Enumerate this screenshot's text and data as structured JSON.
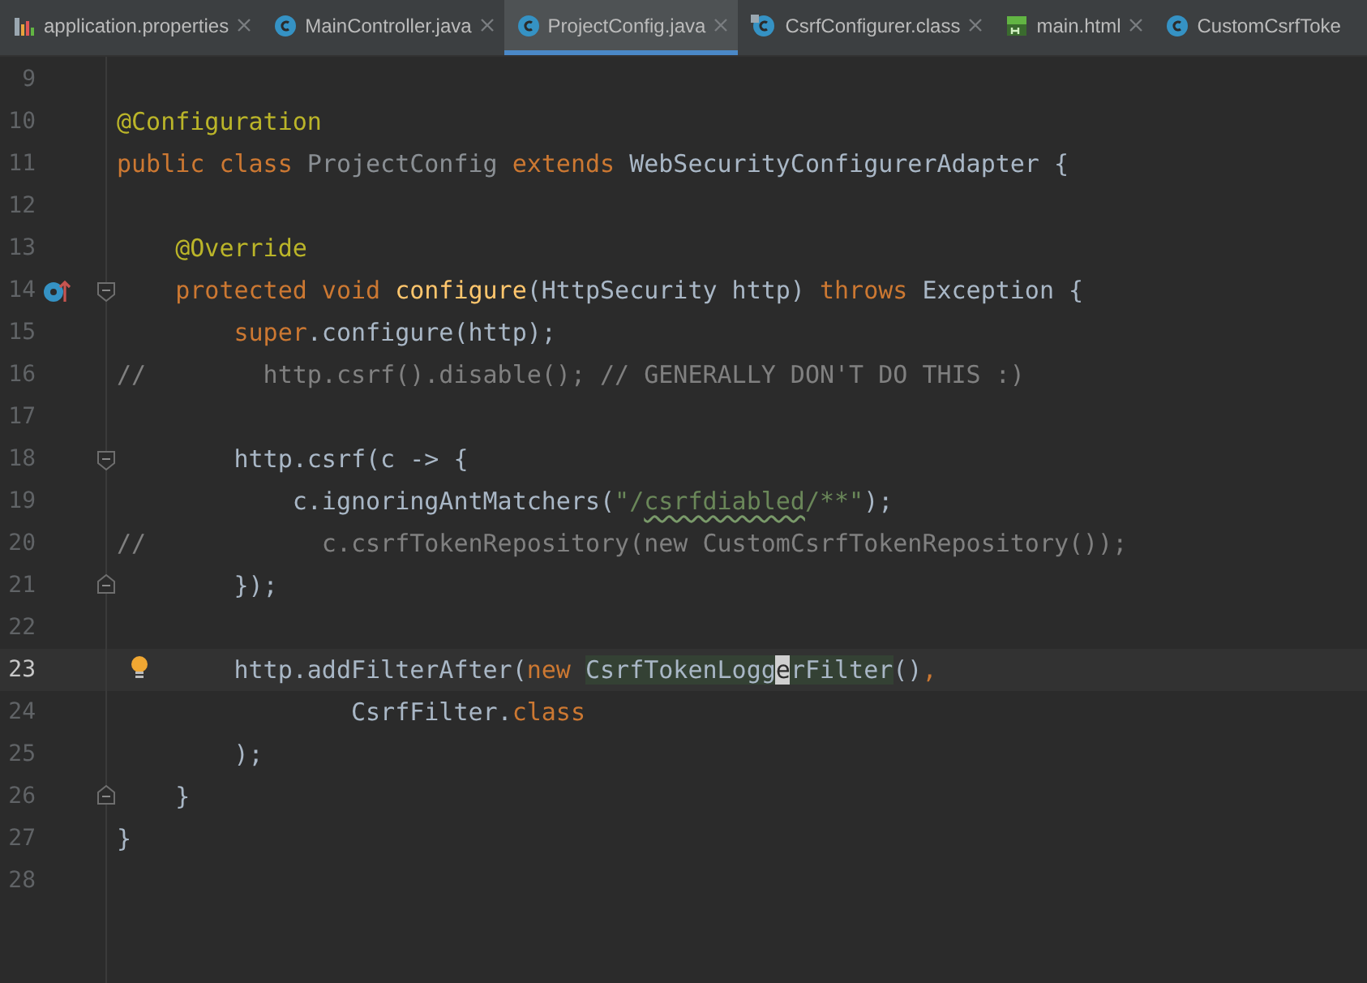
{
  "tabs": [
    {
      "label": "application.properties",
      "kind": "properties",
      "selected": false
    },
    {
      "label": "MainController.java",
      "kind": "class",
      "selected": false
    },
    {
      "label": "ProjectConfig.java",
      "kind": "class",
      "selected": true
    },
    {
      "label": "CsrfConfigurer.class",
      "kind": "compiled",
      "selected": false
    },
    {
      "label": "main.html",
      "kind": "html",
      "selected": false
    },
    {
      "label": "CustomCsrfToke",
      "kind": "class",
      "selected": false
    }
  ],
  "lines": [
    {
      "number": "9",
      "current": false
    },
    {
      "number": "10",
      "current": false,
      "tokens": [
        {
          "kind": "annotation",
          "t": "@Configuration"
        }
      ]
    },
    {
      "number": "11",
      "current": false,
      "tokens": [
        {
          "kind": "keyword",
          "t": "public class "
        },
        {
          "kind": "unused",
          "t": "ProjectConfig"
        },
        {
          "kind": "keyword",
          "t": " extends "
        },
        {
          "kind": "plain",
          "t": "WebSecurityConfigurerAdapter {"
        }
      ]
    },
    {
      "number": "12",
      "current": false
    },
    {
      "number": "13",
      "current": false,
      "tokens": [
        {
          "kind": "annotation",
          "t": "    @Override"
        }
      ]
    },
    {
      "number": "14",
      "current": false,
      "marker": {
        "kind": "override"
      },
      "fold": {
        "kind": "start"
      },
      "tokens": [
        {
          "kind": "keyword",
          "t": "    protected void "
        },
        {
          "kind": "method",
          "t": "configure"
        },
        {
          "kind": "plain",
          "t": "(HttpSecurity http) "
        },
        {
          "kind": "keyword",
          "t": "throws"
        },
        {
          "kind": "plain",
          "t": " Exception {"
        }
      ]
    },
    {
      "number": "15",
      "current": false,
      "tokens": [
        {
          "kind": "keyword",
          "t": "        super"
        },
        {
          "kind": "plain",
          "t": ".configure(http);"
        }
      ]
    },
    {
      "number": "16",
      "current": false,
      "tokens": [
        {
          "kind": "comment",
          "t": "//        http.csrf().disable(); // GENERALLY DON'T DO THIS :)"
        }
      ]
    },
    {
      "number": "17",
      "current": false
    },
    {
      "number": "18",
      "current": false,
      "fold": {
        "kind": "start"
      },
      "tokens": [
        {
          "kind": "plain",
          "t": "        http.csrf(c -> {"
        }
      ]
    },
    {
      "number": "19",
      "current": false,
      "tokens": [
        {
          "kind": "plain",
          "t": "            c.ignoringAntMatchers("
        },
        {
          "kind": "string",
          "t": "\"/"
        },
        {
          "kind": "typo",
          "t": "csrfdiabled"
        },
        {
          "kind": "string",
          "t": "/**\""
        },
        {
          "kind": "plain",
          "t": ");"
        }
      ]
    },
    {
      "number": "20",
      "current": false,
      "tokens": [
        {
          "kind": "comment",
          "t": "//            c.csrfTokenRepository(new CustomCsrfTokenRepository());"
        }
      ]
    },
    {
      "number": "21",
      "current": false,
      "fold": {
        "kind": "end"
      },
      "tokens": [
        {
          "kind": "plain",
          "t": "        });"
        }
      ]
    },
    {
      "number": "22",
      "current": false
    },
    {
      "number": "23",
      "current": true,
      "marker": {
        "kind": "bulb"
      },
      "tokens": [
        {
          "kind": "plain",
          "t": "        http.addFilterAfter("
        },
        {
          "kind": "keyword",
          "t": "new "
        },
        {
          "kind": "highlight",
          "t": "CsrfTokenLogg"
        },
        {
          "kind": "caret",
          "t": "e"
        },
        {
          "kind": "highlight",
          "t": "rFilter"
        },
        {
          "kind": "plain",
          "t": "()"
        },
        {
          "kind": "keyword",
          "t": ","
        }
      ]
    },
    {
      "number": "24",
      "current": false,
      "tokens": [
        {
          "kind": "plain",
          "t": "                CsrfFilter."
        },
        {
          "kind": "keyword",
          "t": "class"
        }
      ]
    },
    {
      "number": "25",
      "current": false,
      "tokens": [
        {
          "kind": "plain",
          "t": "        );"
        }
      ]
    },
    {
      "number": "26",
      "current": false,
      "fold": {
        "kind": "end"
      },
      "tokens": [
        {
          "kind": "plain",
          "t": "    }"
        }
      ]
    },
    {
      "number": "27",
      "current": false,
      "tokens": [
        {
          "kind": "plain",
          "t": "}"
        }
      ]
    },
    {
      "number": "28",
      "current": false
    }
  ]
}
